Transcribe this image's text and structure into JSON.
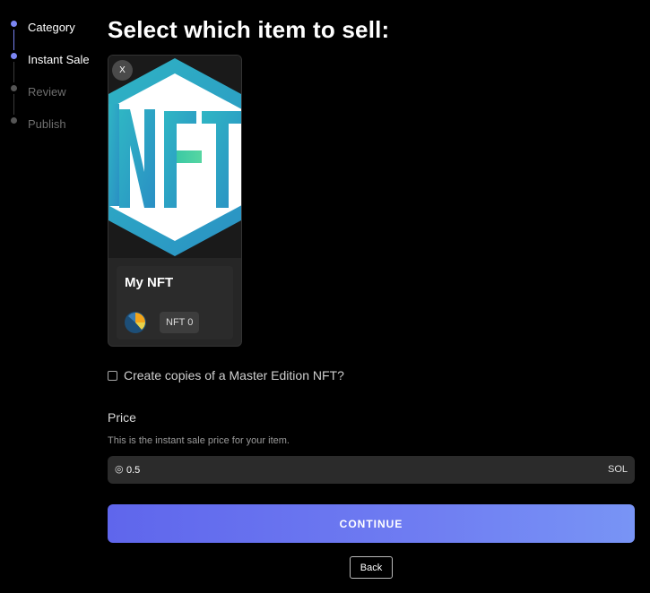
{
  "steps": {
    "items": [
      {
        "label": "Category",
        "state": "done"
      },
      {
        "label": "Instant Sale",
        "state": "current"
      },
      {
        "label": "Review",
        "state": "upcoming"
      },
      {
        "label": "Publish",
        "state": "upcoming"
      }
    ]
  },
  "main": {
    "title": "Select which item to sell:"
  },
  "nft_card": {
    "remove_label": "X",
    "name": "My NFT",
    "badge": "NFT 0",
    "image_icon": "nft-hexagon-logo",
    "avatar_icon": "creator-avatar"
  },
  "master_edition": {
    "label": "Create copies of a Master Edition NFT?",
    "checked": false
  },
  "price": {
    "title": "Price",
    "help": "This is the instant sale price for your item.",
    "prefix": "◎",
    "value": "0.5",
    "currency": "SOL"
  },
  "actions": {
    "continue_label": "CONTINUE",
    "back_label": "Back"
  },
  "colors": {
    "accent": "#6f7df2",
    "background": "#000000",
    "nft_teal": "#2bb3c0"
  }
}
